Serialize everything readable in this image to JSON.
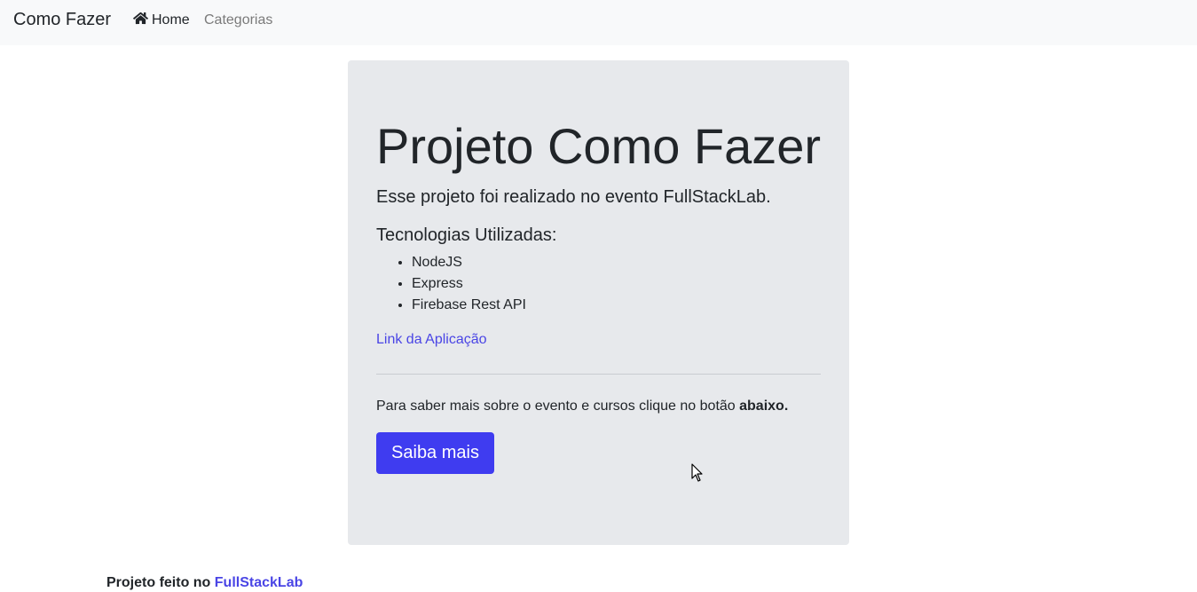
{
  "navbar": {
    "brand": "Como Fazer",
    "items": [
      {
        "label": "Home",
        "icon": "home-icon",
        "active": true
      },
      {
        "label": "Categorias",
        "active": false
      }
    ]
  },
  "jumbotron": {
    "title": "Projeto Como Fazer",
    "lead": "Esse projeto foi realizado no evento FullStackLab.",
    "tech_title": "Tecnologias Utilizadas:",
    "technologies": [
      "NodeJS",
      "Express",
      "Firebase Rest API"
    ],
    "app_link": "Link da Aplicação",
    "info_text": "Para saber mais sobre o evento e cursos clique no botão ",
    "info_bold": "abaixo.",
    "button_label": "Saiba mais"
  },
  "footer": {
    "text": "Projeto feito no ",
    "link": "FullStackLab"
  },
  "colors": {
    "accent": "#3f3cf0",
    "link": "#4a45e5",
    "navbar_bg": "#f8f9fa",
    "jumbotron_bg": "#e7e9ec"
  }
}
